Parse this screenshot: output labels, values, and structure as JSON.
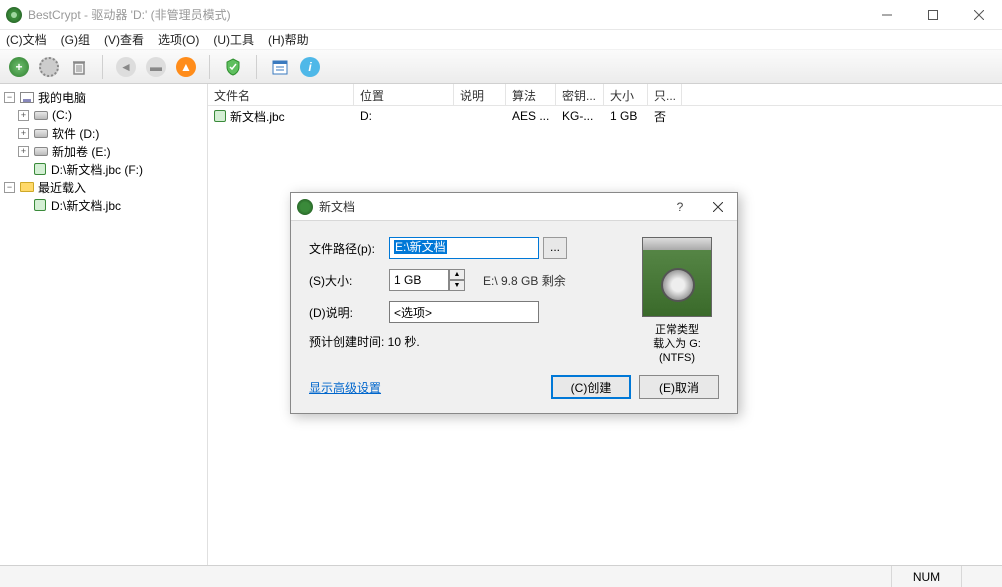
{
  "window": {
    "title": "BestCrypt - 驱动器 'D:' (非管理员模式)"
  },
  "menu": {
    "file": "(C)文档",
    "group": "(G)组",
    "view": "(V)查看",
    "options": "选项(O)",
    "tools": "(U)工具",
    "help": "(H)帮助"
  },
  "tree": {
    "root": "我的电脑",
    "c": "(C:)",
    "d": "软件 (D:)",
    "e": "新加卷 (E:)",
    "f": "D:\\新文档.jbc (F:)",
    "recent": "最近载入",
    "recent1": "D:\\新文档.jbc"
  },
  "list": {
    "headers": {
      "name": "文件名",
      "location": "位置",
      "desc": "说明",
      "algo": "算法",
      "key": "密钥...",
      "size": "大小",
      "ro": "只..."
    },
    "row": {
      "name": "新文档.jbc",
      "location": "D:",
      "desc": "",
      "algo": "AES ...",
      "key": "KG-...",
      "size": "1 GB",
      "ro": "否"
    }
  },
  "dialog": {
    "title": "新文档",
    "path_label": "文件路径(p):",
    "path_value": "E:\\新文档",
    "size_label": "(S)大小:",
    "size_value": "1 GB",
    "free": "E:\\ 9.8 GB 剩余",
    "desc_label": "(D)说明:",
    "desc_placeholder": "<选项>",
    "estimate": "预计创建时间: 10 秒.",
    "preview_type": "正常类型",
    "preview_mount": "载入为 G: (NTFS)",
    "advanced": "显示高级设置",
    "create": "(C)创建",
    "cancel": "(E)取消"
  },
  "status": {
    "num": "NUM"
  }
}
